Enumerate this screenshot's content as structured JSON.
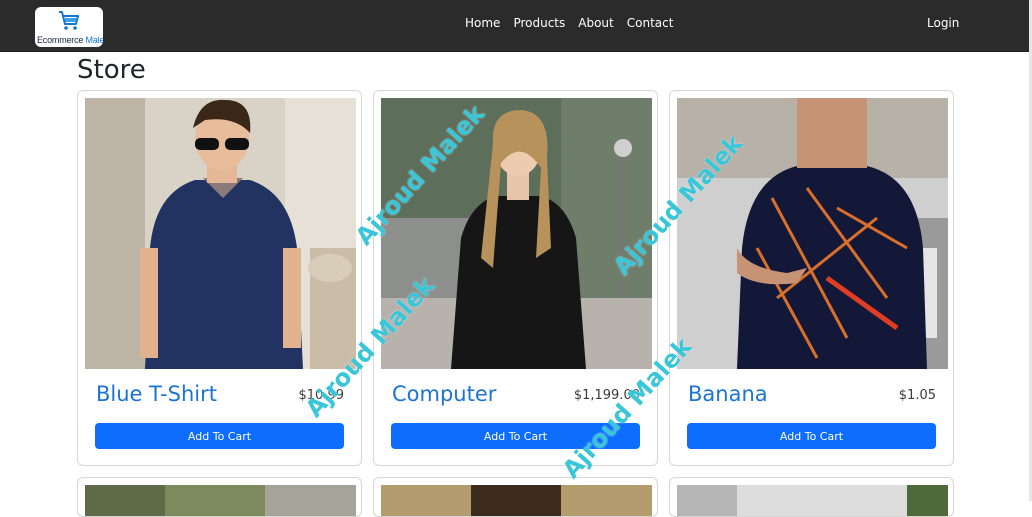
{
  "navbar": {
    "brand": {
      "text_part1": "Ecommerce ",
      "text_part2": "Malek",
      "icon": "shopping-cart-icon"
    },
    "links": [
      {
        "label": "Home"
      },
      {
        "label": "Products"
      },
      {
        "label": "About"
      },
      {
        "label": "Contact"
      }
    ],
    "login_label": "Login"
  },
  "page": {
    "title": "Store"
  },
  "products": [
    {
      "name": "Blue T-Shirt",
      "price": "$10.99",
      "button_label": "Add To Cart",
      "image": "man-in-navy-polo-shirt-photo"
    },
    {
      "name": "Computer",
      "price": "$1,199.00",
      "button_label": "Add To Cart",
      "image": "woman-in-black-dress-photo"
    },
    {
      "name": "Banana",
      "price": "$1.05",
      "button_label": "Add To Cart",
      "image": "man-in-printed-shirt-photo"
    }
  ],
  "watermark_text": "Ajroud Malek",
  "colors": {
    "navbar_bg": "#2b2b2b",
    "accent_button": "#0d6efd",
    "product_name": "#1b74d4",
    "watermark": "#38c6d8"
  }
}
